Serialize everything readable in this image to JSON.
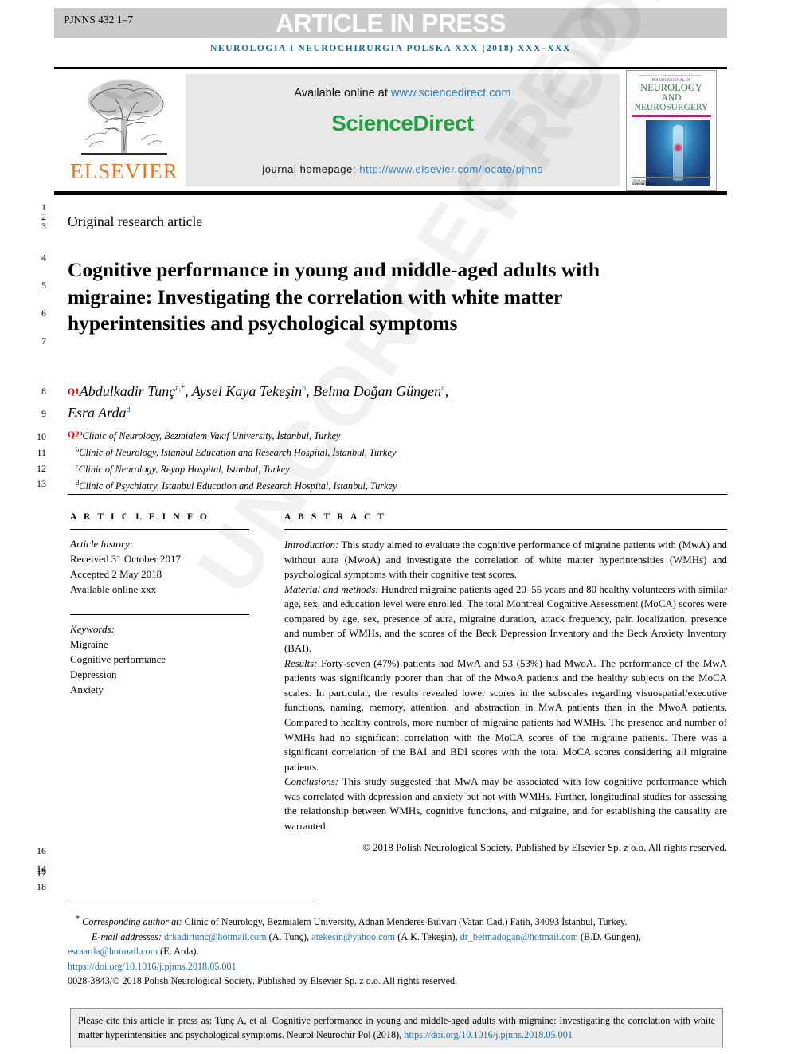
{
  "banner": {
    "code": "PJNNS 432 1–7",
    "title": "ARTICLE IN PRESS",
    "journal_line": "NEUROLOGIA I NEUROCHIRURGIA POLSKA XXX (2018) XXX–XXX",
    "bg_color": "#cacaca"
  },
  "masthead": {
    "publisher": "ELSEVIER",
    "available_prefix": "Available online at ",
    "available_url": "www.sciencedirect.com",
    "sciencedirect": "ScienceDirect",
    "homepage_prefix": "journal homepage: ",
    "homepage_url": "http://www.elsevier.com/locate/pjnns",
    "sciencedirect_color": "#21a23e",
    "link_color": "#2a7fc4",
    "cover": {
      "top_line": "NEUROLOGIA I NEUROCHIRURGIA POLSKA",
      "polish_journal": "POLISH JOURNAL OF",
      "neurology": "NEUROLOGY",
      "and_neurosurgery": "AND NEUROSURGERY",
      "foot_small": "Official journal of the Polish Neurological Society",
      "foot_brand": "ElsevierDirect"
    }
  },
  "line_numbers": {
    "top": [
      "1",
      "2",
      "3",
      "4",
      "5",
      "6",
      "7",
      "8",
      "9",
      "10",
      "11",
      "12",
      "13"
    ],
    "bottom": [
      "16",
      "14",
      "15",
      "17",
      "18"
    ]
  },
  "article": {
    "type": "Original research article",
    "title": "Cognitive performance in young and middle-aged adults with migraine: Investigating the correlation with white matter hyperintensities and psychological symptoms",
    "query_flag_1": "Q1",
    "query_flag_2": "Q2",
    "authors": [
      {
        "name": "Abdulkadir Tunç",
        "marks": "a,*"
      },
      {
        "name": "Aysel Kaya Tekeşin",
        "marks": "b"
      },
      {
        "name": "Belma Doğan Güngen",
        "marks": "c"
      },
      {
        "name": "Esra Arda",
        "marks": "d"
      }
    ],
    "affiliations": [
      {
        "mark": "a",
        "text": "Clinic of Neurology, Bezmialem Vakıf University, İstanbul, Turkey"
      },
      {
        "mark": "b",
        "text": "Clinic of Neurology, Istanbul Education and Research Hospital, İstanbul, Turkey"
      },
      {
        "mark": "c",
        "text": "Clinic of Neurology, Reyap Hospital, Istanbul, Turkey"
      },
      {
        "mark": "d",
        "text": "Clinic of Psychiatry, Istanbul Education and Research Hospital, Istanbul, Turkey"
      }
    ]
  },
  "article_info": {
    "heading": "A R T I C L E  I N F O",
    "history_label": "Article history:",
    "received": "Received 31 October 2017",
    "accepted": "Accepted 2 May 2018",
    "available": "Available online xxx",
    "keywords_label": "Keywords:",
    "keywords": [
      "Migraine",
      "Cognitive performance",
      "Depression",
      "Anxiety"
    ]
  },
  "abstract": {
    "heading": "A B S T R A C T",
    "sections": [
      {
        "label": "Introduction:",
        "text": " This study aimed to evaluate the cognitive performance of migraine patients with (MwA) and without aura (MwoA) and investigate the correlation of white matter hyperintensities (WMHs) and psychological symptoms with their cognitive test scores."
      },
      {
        "label": "Material and methods:",
        "text": " Hundred migraine patients aged 20–55 years and 80 healthy volunteers with similar age, sex, and education level were enrolled. The total Montreal Cognitive Assessment (MoCA) scores were compared by age, sex, presence of aura, migraine duration, attack frequency, pain localization, presence and number of WMHs, and the scores of the Beck Depression Inventory and the Beck Anxiety Inventory (BAI)."
      },
      {
        "label": "Results:",
        "text": " Forty-seven (47%) patients had MwA and 53 (53%) had MwoA. The performance of the MwA patients was significantly poorer than that of the MwoA patients and the healthy subjects on the MoCA scales. In particular, the results revealed lower scores in the subscales regarding visuospatial/executive functions, naming, memory, attention, and abstraction in MwA patients than in the MwoA patients. Compared to healthy controls, more number of migraine patients had WMHs. The presence and number of WMHs had no significant correlation with the MoCA scores of the migraine patients. There was a significant correlation of the BAI and BDI scores with the total MoCA scores considering all migraine patients."
      },
      {
        "label": "Conclusions:",
        "text": " This study suggested that MwA may be associated with low cognitive performance which was correlated with depression and anxiety but not with WMHs. Further, longitudinal studies for assessing the relationship between WMHs, cognitive functions, and migraine, and for establishing the causality are warranted."
      }
    ],
    "copyright": "© 2018 Polish Neurological Society. Published by Elsevier Sp. z o.o. All rights reserved."
  },
  "footnotes": {
    "corresponding_marker": "*",
    "corresponding_label": "Corresponding author at:",
    "corresponding_address": " Clinic of Neurology, Bezmialem University, Adnan Menderes Bulvarı (Vatan Cad.) Fatih, 34093 İstanbul, Turkey.",
    "email_label": "E-mail addresses:",
    "emails": [
      {
        "address": "drkadirtunc@hotmail.com",
        "owner": " (A. Tunç), "
      },
      {
        "address": "atekesin@yahoo.com",
        "owner": " (A.K. Tekeşin), "
      },
      {
        "address": "dr_belmadogan@hotmail.com",
        "owner": " (B.D. Güngen), "
      },
      {
        "address": "esraarda@hotmail.com",
        "owner": " (E. Arda)."
      }
    ],
    "doi": "https://doi.org/10.1016/j.pjnns.2018.05.001",
    "issn_line": "0028-3843/© 2018 Polish Neurological Society. Published by Elsevier Sp. z o.o. All rights reserved."
  },
  "citation_box": {
    "text": "Please cite this article in press as: Tunç A, et al. Cognitive performance in young and middle-aged adults with migraine: Investigating the correlation with white matter hyperintensities and psychological symptoms. Neurol Neurochir Pol (2018), ",
    "link": "https://doi.org/10.1016/j.pjnns.2018.05.001",
    "bg_color": "#ececec"
  },
  "watermark": {
    "line1": "PROOF",
    "line2": "UNCORRECTED"
  }
}
